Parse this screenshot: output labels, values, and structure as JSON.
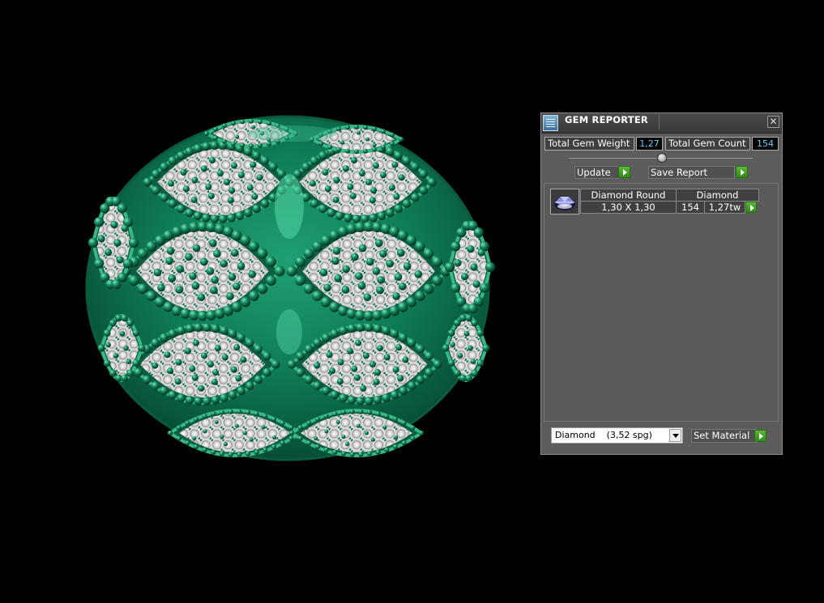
{
  "panel": {
    "title": "GEM REPORTER",
    "close_glyph": "✕",
    "total_weight_label": "Total Gem Weight",
    "total_weight_value": "1,27",
    "total_count_label": "Total Gem Count",
    "total_count_value": "154",
    "update_label": "Update",
    "save_report_label": "Save Report",
    "gem_row": {
      "name": "Diamond Round",
      "material": "Diamond",
      "size": "1,30 X 1,30",
      "count": "154",
      "weight": "1,27tw"
    },
    "material_select_value": "Diamond    (3,52 spg)",
    "set_material_label": "Set Material"
  },
  "colors": {
    "metal": "#0f7a55",
    "highlight": "#39c08e",
    "gem": "#f2f2f2",
    "panel_bg": "#5c5c5c",
    "value_text": "#5fd0ff",
    "action_green": "#3fa524"
  },
  "icons": {
    "title": "gem-reporter-icon",
    "close": "close-icon",
    "play": "play-arrow-icon",
    "dropdown": "chevron-down-icon"
  }
}
